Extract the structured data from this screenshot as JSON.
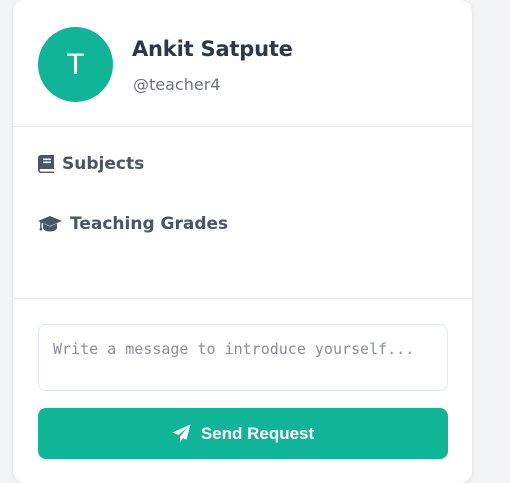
{
  "profile": {
    "avatar_initial": "T",
    "name": "Ankit Satpute",
    "username": "@teacher4"
  },
  "info": {
    "subjects_label": "Subjects",
    "grades_label": "Teaching Grades"
  },
  "request": {
    "message_placeholder": "Write a message to introduce yourself...",
    "message_value": "",
    "send_label": "Send Request"
  },
  "icons": {
    "subjects": "book-icon",
    "grades": "graduation-cap-icon",
    "send": "paper-plane-icon"
  },
  "colors": {
    "accent": "#10b597",
    "text_primary": "#2d3748",
    "text_secondary": "#6b7280"
  }
}
